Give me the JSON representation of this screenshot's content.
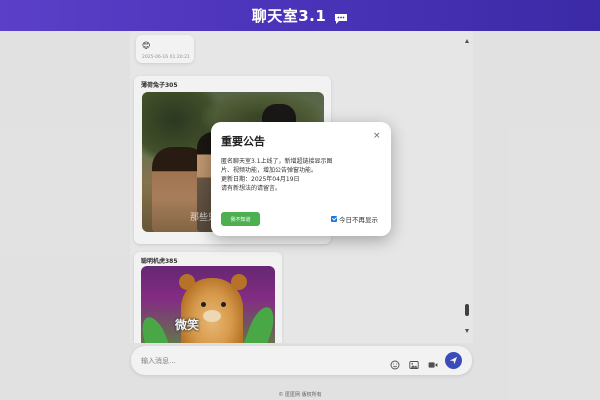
{
  "header": {
    "title": "聊天室3.1"
  },
  "messages": [
    {
      "emoji": "😊",
      "time": "2025-06-16 01:20:21"
    },
    {
      "name": "薄荷兔子305",
      "image_caption": "那些只是"
    },
    {
      "name": "聪明机虎385",
      "image_caption": "微笑"
    }
  ],
  "modal": {
    "title": "重要公告",
    "close": "×",
    "lines": [
      "匿名聊天室3.1上线了，新增超链接显示图",
      "片、视频功能，增加公告弹窗功能。",
      "更新日期：2025年04月19日",
      "请有新想法的请留言。"
    ],
    "button_label": "我不知道",
    "checkbox_label": "今日不再显示",
    "checkbox_checked": true
  },
  "input": {
    "placeholder": "输入消息...",
    "value": ""
  },
  "footer": {
    "text": "© 匿匿网 版权所有"
  },
  "colors": {
    "header_start": "#5b3fc8",
    "header_end": "#3b2aa6",
    "primary_button": "#4caf50",
    "send_button": "#3f51c4",
    "checkbox": "#1a73e8"
  },
  "icons": [
    "chat-bubble-icon",
    "emoji-icon",
    "image-icon",
    "video-icon",
    "send-icon",
    "close-icon"
  ]
}
